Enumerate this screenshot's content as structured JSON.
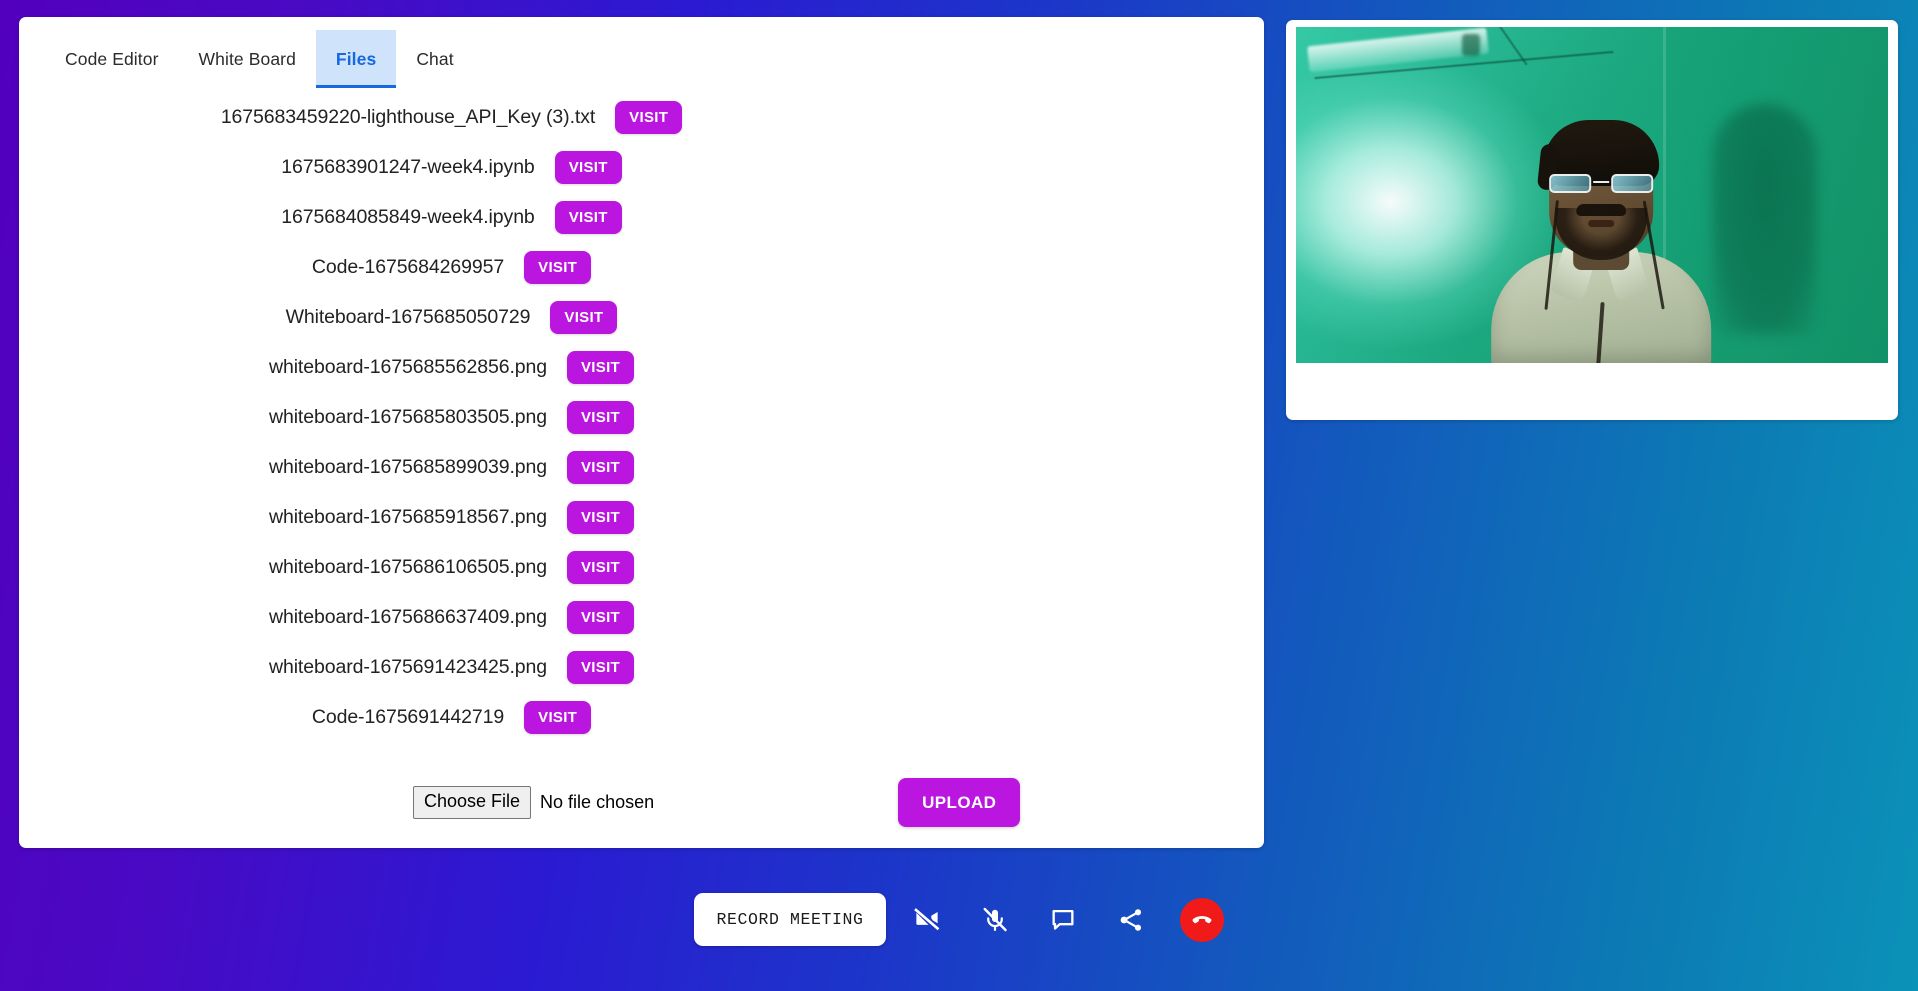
{
  "app": {
    "background_gradient_from": "#5200bd",
    "background_gradient_to": "#0b92b8"
  },
  "tabs": [
    {
      "label": "Code Editor",
      "active": false
    },
    {
      "label": "White Board",
      "active": false
    },
    {
      "label": "Files",
      "active": true
    },
    {
      "label": "Chat",
      "active": false
    }
  ],
  "files_panel": {
    "visit_label": "VISIT",
    "files": [
      {
        "name": "1675683459220-lighthouse_API_Key (3).txt"
      },
      {
        "name": "1675683901247-week4.ipynb"
      },
      {
        "name": "1675684085849-week4.ipynb"
      },
      {
        "name": "Code-1675684269957"
      },
      {
        "name": "Whiteboard-1675685050729"
      },
      {
        "name": "whiteboard-1675685562856.png"
      },
      {
        "name": "whiteboard-1675685803505.png"
      },
      {
        "name": "whiteboard-1675685899039.png"
      },
      {
        "name": "whiteboard-1675685918567.png"
      },
      {
        "name": "whiteboard-1675686106505.png"
      },
      {
        "name": "whiteboard-1675686637409.png"
      },
      {
        "name": "whiteboard-1675691423425.png"
      },
      {
        "name": "Code-1675691442719"
      }
    ],
    "upload": {
      "choose_file_label": "Choose File",
      "no_file_text": "No file chosen",
      "upload_label": "UPLOAD",
      "button_color": "#bb16e0"
    }
  },
  "video_panel": {
    "participant_visible": true
  },
  "bottom_toolbar": {
    "record_label": "RECORD MEETING",
    "icons": [
      {
        "name": "video-off-icon"
      },
      {
        "name": "mic-off-icon"
      },
      {
        "name": "chat-icon"
      },
      {
        "name": "share-icon"
      }
    ],
    "end_call": {
      "name": "end-call-icon",
      "color": "#f01a1a"
    }
  }
}
